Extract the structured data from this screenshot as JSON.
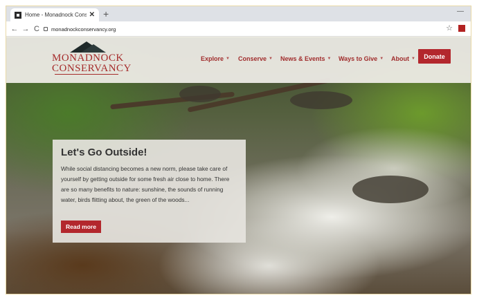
{
  "browser": {
    "tab_title": "Home - Monadnock Conservanc",
    "tab_close": "✕",
    "new_tab": "+",
    "minimize": "—",
    "back": "←",
    "forward": "→",
    "reload": "C",
    "url": "monadnockconservancy.org",
    "star": "☆"
  },
  "site": {
    "logo_line1": "MONADNOCK",
    "logo_line2": "CONSERVANCY",
    "nav": [
      {
        "label": "Explore",
        "caret": "▼"
      },
      {
        "label": "Conserve",
        "caret": "▼"
      },
      {
        "label": "News & Events",
        "caret": "▼"
      },
      {
        "label": "Ways to Give",
        "caret": "▼"
      },
      {
        "label": "About",
        "caret": "▼"
      }
    ],
    "donate_label": "Donate"
  },
  "hero": {
    "title": "Let's Go Outside!",
    "body": "While social distancing becomes a new norm, please take care of yourself by getting outside for some fresh air close to home. There are so many benefits to nature: sunshine, the sounds of running water, birds flitting about, the green of the woods...",
    "button_label": "Read more"
  },
  "colors": {
    "brand_red": "#b3272d",
    "nav_text": "#a02c2c"
  }
}
